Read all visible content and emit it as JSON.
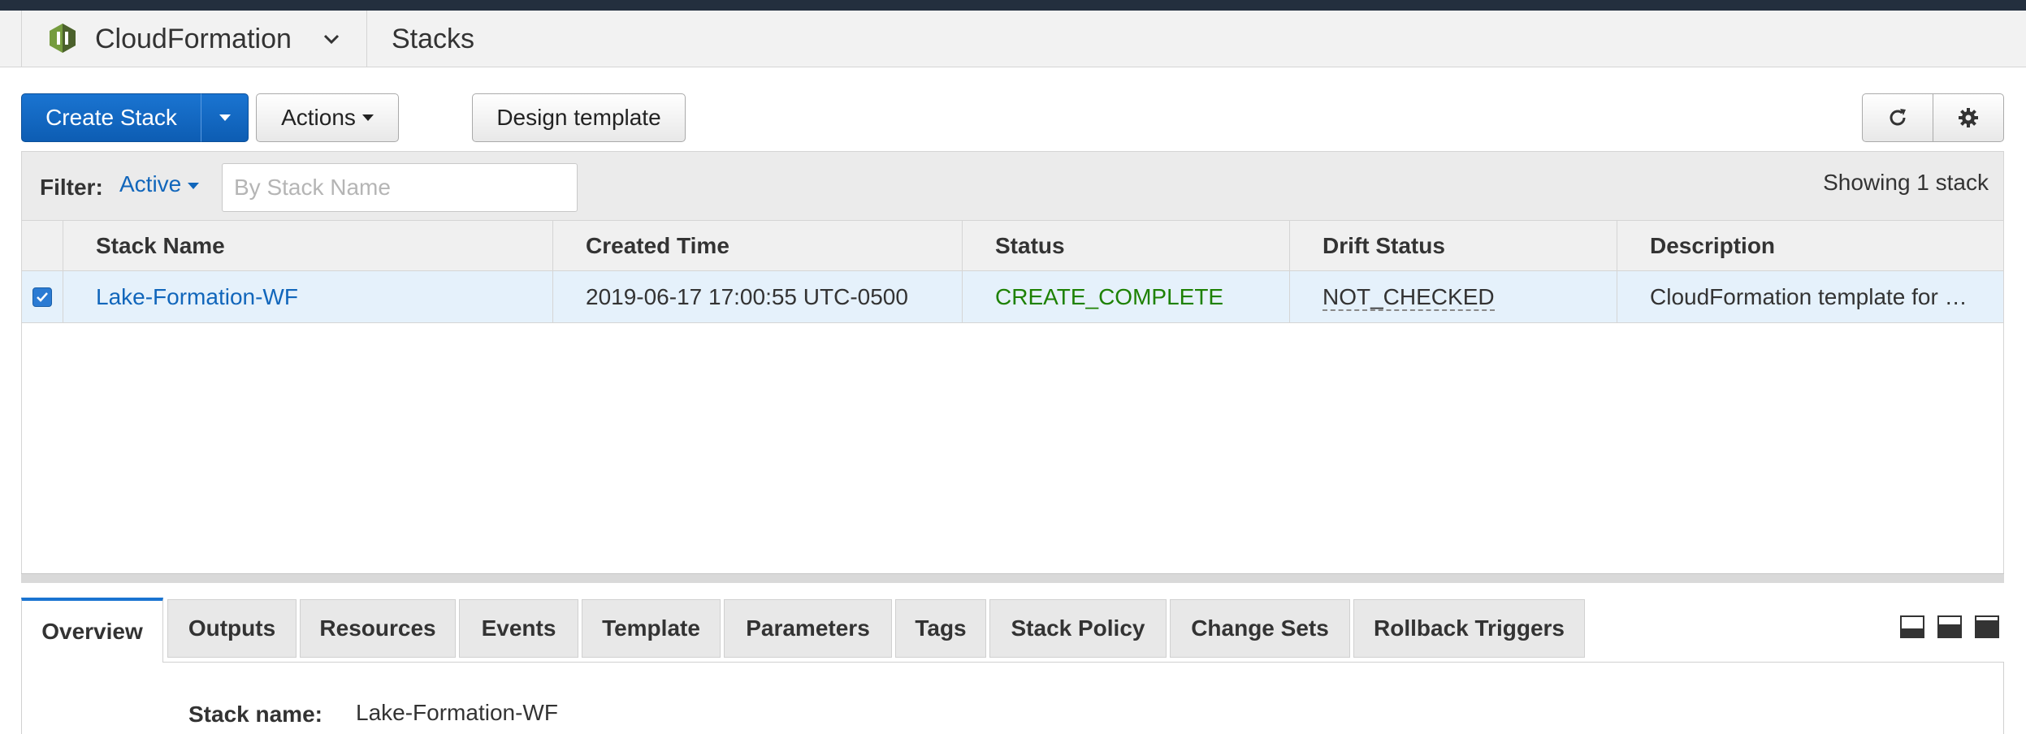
{
  "service": {
    "name": "CloudFormation",
    "page": "Stacks"
  },
  "toolbar": {
    "create_stack": "Create Stack",
    "actions": "Actions",
    "design_template": "Design template"
  },
  "filter": {
    "label": "Filter:",
    "active": "Active",
    "placeholder": "By Stack Name",
    "showing": "Showing 1 stack"
  },
  "table": {
    "columns": [
      "Stack Name",
      "Created Time",
      "Status",
      "Drift Status",
      "Description"
    ],
    "rows": [
      {
        "selected": true,
        "stack_name": "Lake-Formation-WF",
        "created_time": "2019-06-17 17:00:55 UTC-0500",
        "status": "CREATE_COMPLETE",
        "drift_status": "NOT_CHECKED",
        "description": "CloudFormation template for …"
      }
    ]
  },
  "tabs": [
    "Overview",
    "Outputs",
    "Resources",
    "Events",
    "Template",
    "Parameters",
    "Tags",
    "Stack Policy",
    "Change Sets",
    "Rollback Triggers"
  ],
  "active_tab": "Overview",
  "details": {
    "stack_name_label": "Stack name:",
    "stack_name_value": "Lake-Formation-WF"
  },
  "colors": {
    "primary": "#1a74d1",
    "link": "#1166bb",
    "status_ok": "#1d8102",
    "selected_row": "#e5f1fb",
    "topbar": "#232f3e"
  }
}
